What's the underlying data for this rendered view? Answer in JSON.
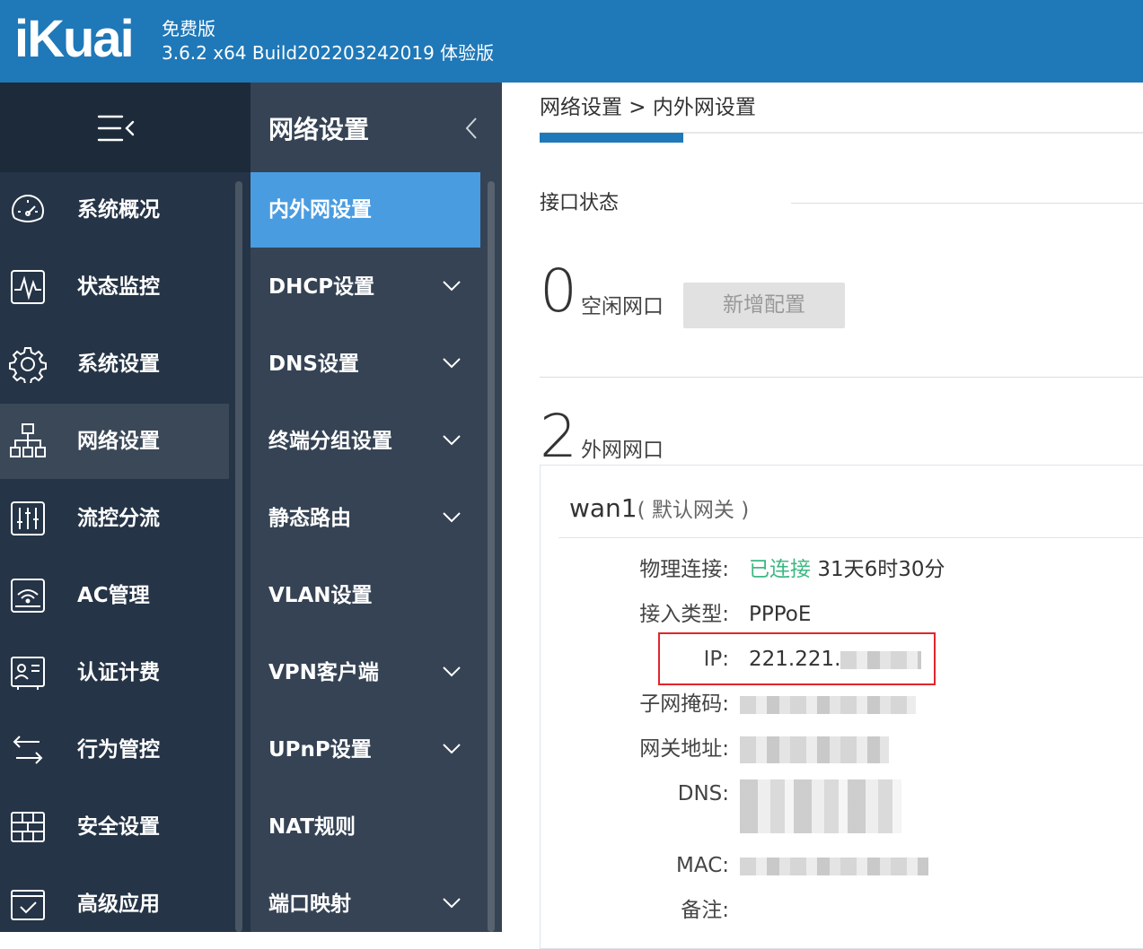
{
  "header": {
    "logo": "iKuai",
    "edition": "免费版",
    "version": "3.6.2 x64 Build202203242019 体验版"
  },
  "nav_primary": {
    "items": [
      {
        "label": "系统概况",
        "icon": "dashboard-gauge-icon"
      },
      {
        "label": "状态监控",
        "icon": "pulse-monitor-icon"
      },
      {
        "label": "系统设置",
        "icon": "gear-icon"
      },
      {
        "label": "网络设置",
        "icon": "network-topology-icon",
        "active": true
      },
      {
        "label": "流控分流",
        "icon": "sliders-icon"
      },
      {
        "label": "AC管理",
        "icon": "wifi-ap-icon"
      },
      {
        "label": "认证计费",
        "icon": "id-card-icon"
      },
      {
        "label": "行为管控",
        "icon": "swap-arrows-icon"
      },
      {
        "label": "安全设置",
        "icon": "firewall-brick-icon"
      },
      {
        "label": "高级应用",
        "icon": "checkbox-app-icon"
      }
    ]
  },
  "nav_secondary": {
    "title": "网络设置",
    "items": [
      {
        "label": "内外网设置",
        "active": true,
        "expandable": false
      },
      {
        "label": "DHCP设置",
        "expandable": true
      },
      {
        "label": "DNS设置",
        "expandable": true
      },
      {
        "label": "终端分组设置",
        "expandable": true
      },
      {
        "label": "静态路由",
        "expandable": true
      },
      {
        "label": "VLAN设置",
        "expandable": false
      },
      {
        "label": "VPN客户端",
        "expandable": true
      },
      {
        "label": "UPnP设置",
        "expandable": true
      },
      {
        "label": "NAT规则",
        "expandable": false
      },
      {
        "label": "端口映射",
        "expandable": true
      }
    ]
  },
  "main": {
    "breadcrumb": "网络设置 > 内外网设置",
    "section_title": "接口状态",
    "idle": {
      "count": "0",
      "label": "空闲网口",
      "add_button": "新增配置"
    },
    "wan": {
      "count": "2",
      "label": "外网网口"
    },
    "card": {
      "name": "wan1",
      "tag": "( 默认网关 )",
      "rows": {
        "physical_label": "物理连接:",
        "physical_status": "已连接",
        "uptime": "31天6时30分",
        "access_label": "接入类型:",
        "access_value": "PPPoE",
        "ip_label": "IP:",
        "ip_value": "221.221.",
        "mask_label": "子网掩码:",
        "gateway_label": "网关地址:",
        "dns_label": "DNS:",
        "mac_label": "MAC:",
        "note_label": "备注:"
      }
    }
  },
  "colors": {
    "topbar": "#1f78b8",
    "nav_primary": "#253446",
    "nav_secondary": "#354354",
    "active_secondary": "#4a9ce0",
    "connected_green": "#3cb882",
    "highlight_red": "#e0262c"
  }
}
